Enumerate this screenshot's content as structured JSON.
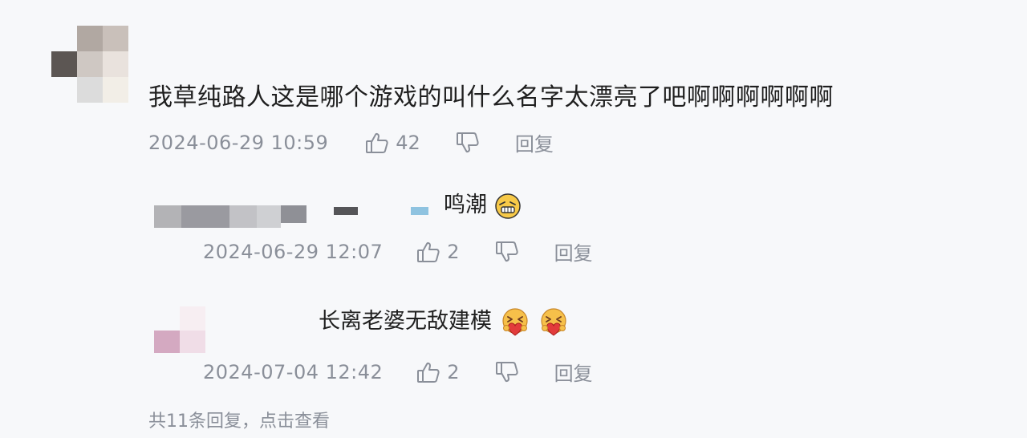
{
  "comment": {
    "text": "我草纯路人这是哪个游戏的叫什么名字太漂亮了吧啊啊啊啊啊啊",
    "time": "2024-06-29 10:59",
    "likes": "42",
    "reply_label": "回复"
  },
  "replies": [
    {
      "text": "鸣潮",
      "emoji": "grimace-emoji",
      "time": "2024-06-29 12:07",
      "likes": "2",
      "reply_label": "回复"
    },
    {
      "text": "长离老婆无敌建模",
      "emoji": "heart-hug-emoji",
      "time": "2024-07-04 12:42",
      "likes": "2",
      "reply_label": "回复"
    }
  ],
  "more_replies": "共11条回复，点击查看"
}
